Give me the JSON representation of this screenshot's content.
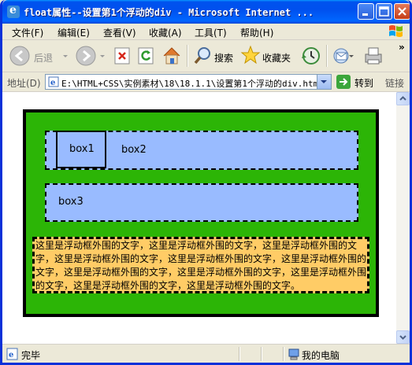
{
  "window": {
    "title": "float属性--设置第1个浮动的div - Microsoft Internet ..."
  },
  "menu": {
    "items": [
      "文件(F)",
      "编辑(E)",
      "查看(V)",
      "收藏(A)",
      "工具(T)",
      "帮助(H)"
    ]
  },
  "toolbar": {
    "back_label": "后退",
    "search_label": "搜索",
    "favorites_label": "收藏夹",
    "more_glyph": "»"
  },
  "address": {
    "label": "地址(D)",
    "value": "E:\\HTML+CSS\\实例素材\\18\\18.1.1\\设置第1个浮动的div.htm",
    "go_label": "转到",
    "links_label": "链接"
  },
  "page": {
    "box1": "box1",
    "box2": "box2",
    "box3": "box3",
    "paragraph": "这里是浮动框外围的文字，这里是浮动框外围的文字，这里是浮动框外围的文字，这里是浮动框外围的文字，这里是浮动框外围的文字，这里是浮动框外围的文字，这里是浮动框外围的文字，这里是浮动框外围的文字，这里是浮动框外围的文字，这里是浮动框外围的文字，这里是浮动框外围的文字。"
  },
  "status": {
    "text": "完毕",
    "zone": "我的电脑"
  },
  "colors": {
    "father_bg": "#2CB506",
    "box_bg": "#99BBFF",
    "paragraph_bg": "#FFCC66"
  }
}
